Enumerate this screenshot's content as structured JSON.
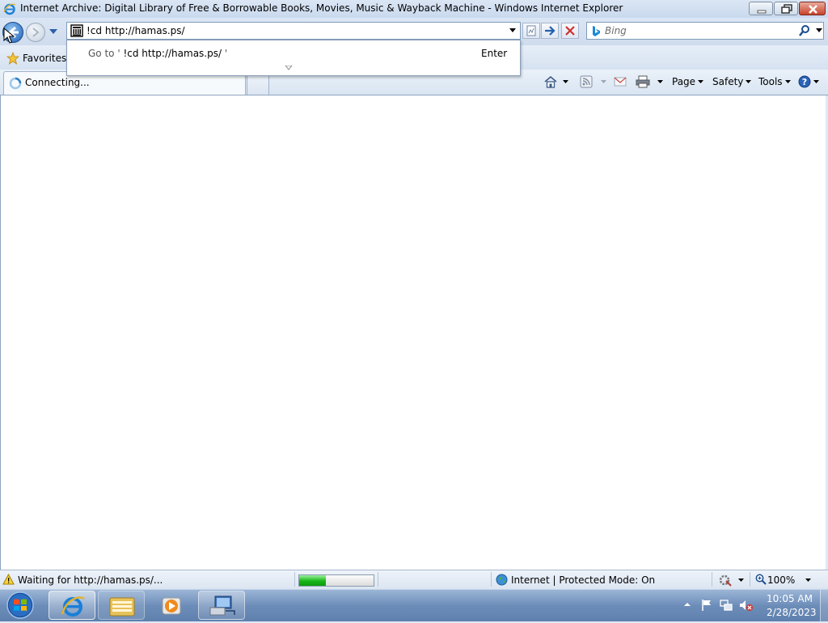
{
  "window": {
    "title": "Internet Archive: Digital Library of Free & Borrowable Books, Movies, Music & Wayback Machine - Windows Internet Explorer"
  },
  "address_bar": {
    "value": "!cd http://hamas.ps/"
  },
  "search": {
    "placeholder": "Bing"
  },
  "suggestion": {
    "go_to_prefix": "Go to '",
    "go_to_value": "!cd http://hamas.ps/",
    "go_to_suffix": "'",
    "enter_label": "Enter"
  },
  "favorites": {
    "label": "Favorites"
  },
  "tab": {
    "label": "Connecting..."
  },
  "command_bar": {
    "page_label": "Page",
    "safety_label": "Safety",
    "tools_label": "Tools"
  },
  "status_bar": {
    "text": "Waiting for http://hamas.ps/...",
    "progress": 0.36,
    "zone_text": "Internet | Protected Mode: On",
    "zoom": "100%"
  },
  "taskbar": {
    "clock_time": "10:05 AM",
    "clock_date": "2/28/2023"
  },
  "colors": {
    "chrome": "#dfe9f5",
    "taskbar": "#6d8db9",
    "progress_green": "#17b617"
  }
}
